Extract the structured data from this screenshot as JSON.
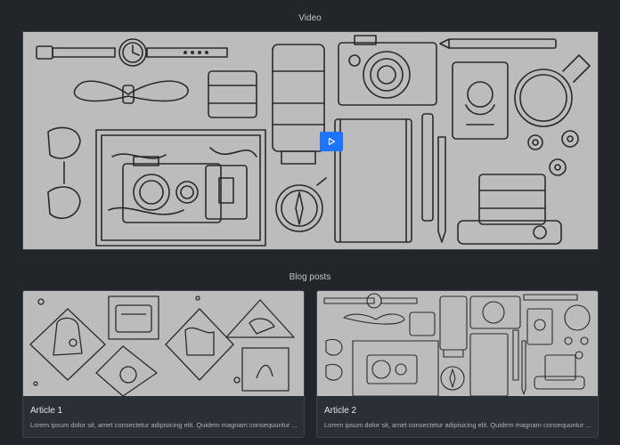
{
  "video_section": {
    "heading": "Video",
    "play_icon": "play-icon",
    "accent_color": "#1f74ff"
  },
  "blog_section": {
    "heading": "Blog posts",
    "articles": [
      {
        "title": "Article 1",
        "excerpt": "Lorem ipsum dolor sit, amet consectetur adipisicing elit. Quidem magnam consequuntur ..."
      },
      {
        "title": "Article 2",
        "excerpt": "Lorem ipsum dolor sit, amet consectetur adipisicing elit. Quidem magnam consequuntur ..."
      }
    ]
  }
}
